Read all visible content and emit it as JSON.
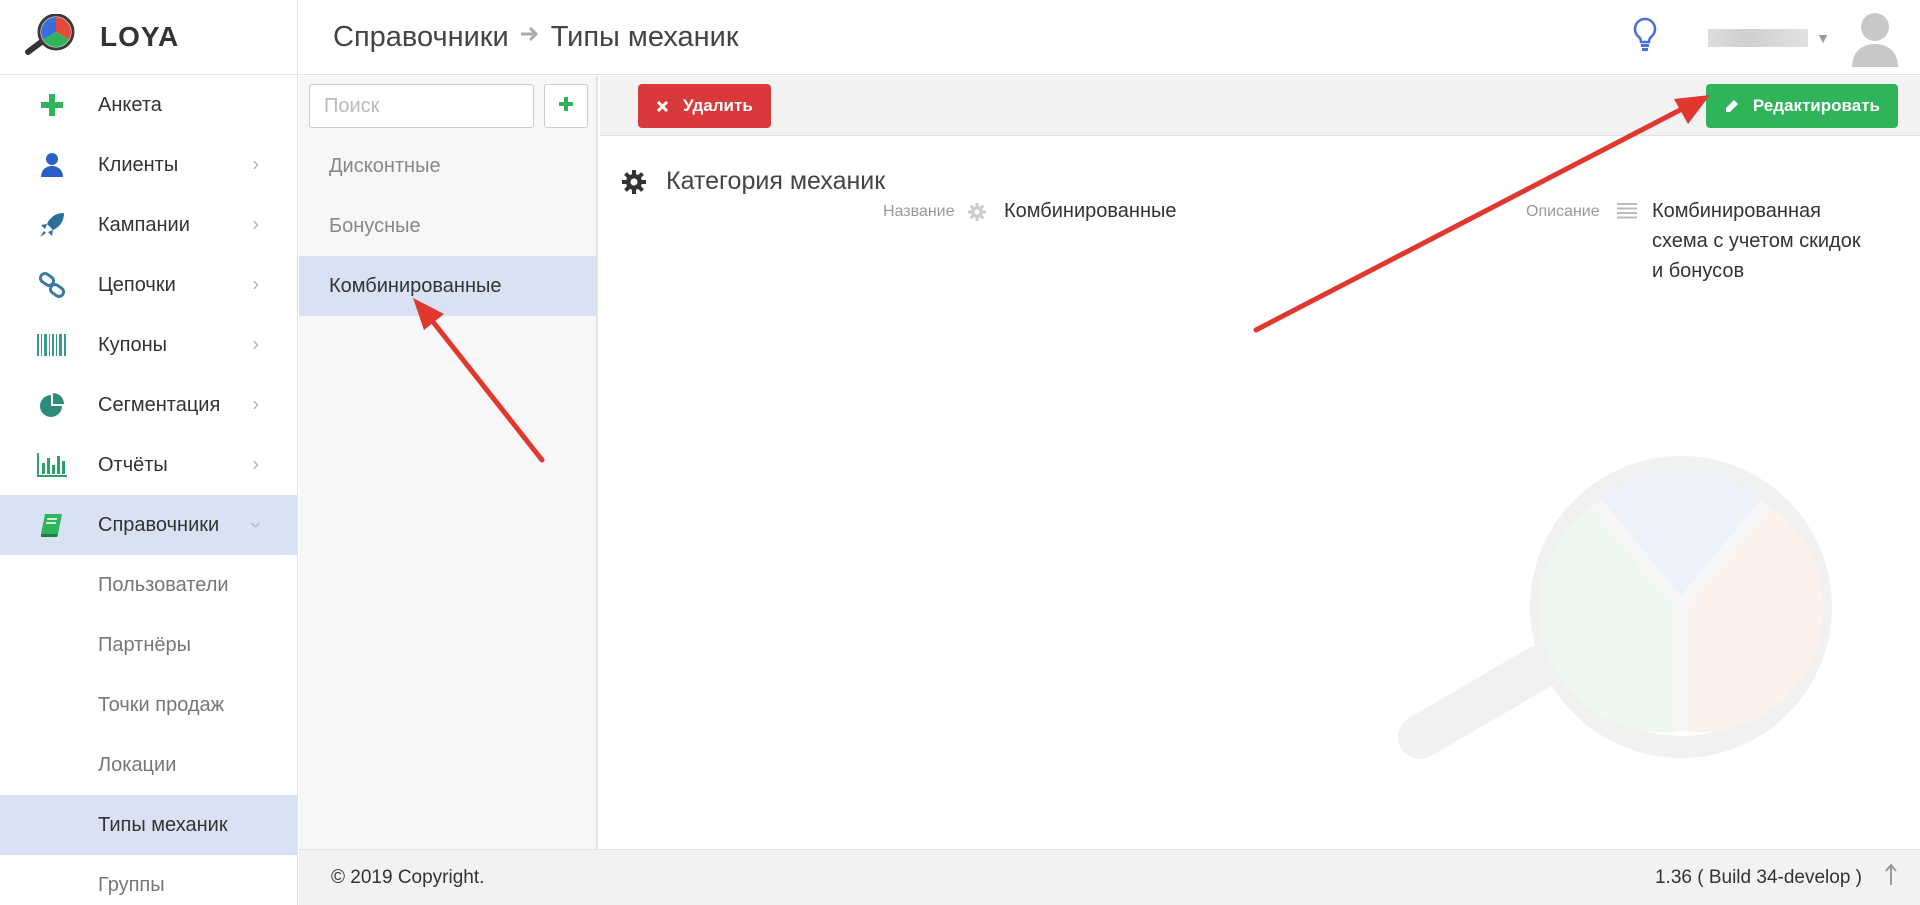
{
  "app": {
    "logo_text": "LOYA"
  },
  "breadcrumb": {
    "parent": "Справочники",
    "current": "Типы механик"
  },
  "sidebar": {
    "items": [
      {
        "label": "Анкета",
        "icon": "plus-icon"
      },
      {
        "label": "Клиенты",
        "icon": "user-icon"
      },
      {
        "label": "Кампании",
        "icon": "rocket-icon"
      },
      {
        "label": "Цепочки",
        "icon": "chain-icon"
      },
      {
        "label": "Купоны",
        "icon": "barcode-icon"
      },
      {
        "label": "Сегментация",
        "icon": "pie-chart-icon"
      },
      {
        "label": "Отчёты",
        "icon": "bar-chart-icon"
      },
      {
        "label": "Справочники",
        "icon": "book-icon"
      }
    ],
    "subitems": [
      {
        "label": "Пользователи"
      },
      {
        "label": "Партнёры"
      },
      {
        "label": "Точки продаж"
      },
      {
        "label": "Локации"
      },
      {
        "label": "Типы механик"
      },
      {
        "label": "Группы"
      }
    ]
  },
  "list": {
    "search_placeholder": "Поиск",
    "items": [
      {
        "label": "Дисконтные"
      },
      {
        "label": "Бонусные"
      },
      {
        "label": "Комбинированные"
      }
    ]
  },
  "toolbar": {
    "delete_label": "Удалить",
    "edit_label": "Редактировать"
  },
  "detail": {
    "section_title": "Категория механик",
    "name_label": "Название",
    "name_value": "Комбинированные",
    "description_label": "Описание",
    "description_line1": "Комбинированная",
    "description_line2": "схема с учетом скидок",
    "description_line3": "и бонусов"
  },
  "footer": {
    "copyright": "© 2019 Copyright.",
    "version": "1.36 ( Build 34-develop )"
  },
  "colors": {
    "accent_blue": "#d9e1f4",
    "danger": "#d9393a",
    "success": "#2fb45a",
    "annotation": "#e0372f"
  }
}
